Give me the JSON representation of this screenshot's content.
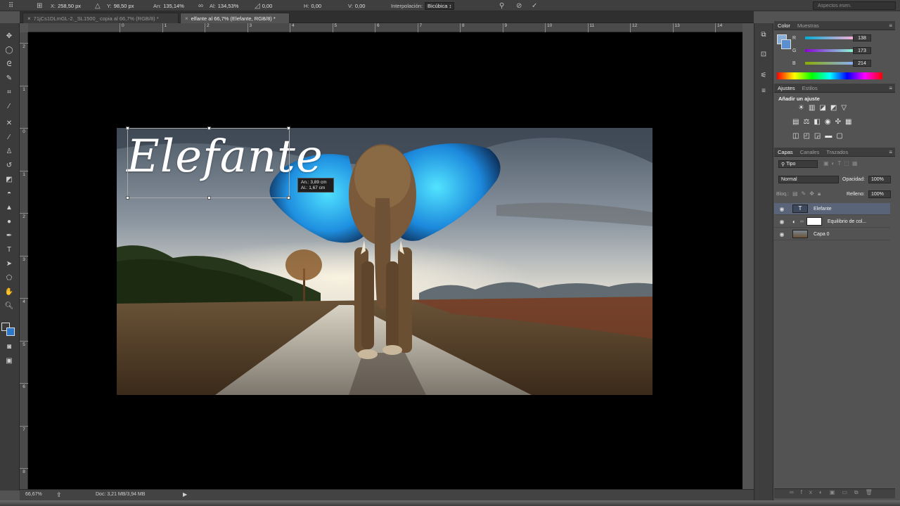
{
  "options_bar": {
    "x_label": "X:",
    "x_value": "258,50 px",
    "y_label": "Y:",
    "y_value": "98,50 px",
    "w_label": "An:",
    "w_value": "135,14%",
    "h_label": "Al:",
    "h_value": "134,53%",
    "angle_value": "0,00",
    "hskew_label": "H:",
    "hskew_value": "0,00",
    "vskew_label": "V:",
    "vskew_value": "0,00",
    "interp_label": "Interpolación:",
    "interp_value": "Bicúbica",
    "workspace_placeholder": "Aspectos esen."
  },
  "tabs": [
    {
      "label": "71jCs1DLmGL-2._SL1500_ copia al 66,7% (RGB/8) *"
    },
    {
      "label": "elfante al 66,7% (Elefante, RGB/8) *"
    }
  ],
  "ruler_top": [
    "0",
    "1",
    "2",
    "3",
    "4",
    "5",
    "6",
    "7",
    "8",
    "9",
    "10",
    "11",
    "12",
    "13",
    "14"
  ],
  "ruler_left": [
    "2",
    "1",
    "0",
    "1",
    "2",
    "3",
    "4",
    "5",
    "6",
    "7",
    "8"
  ],
  "canvas": {
    "title_text": "Elefante",
    "tooltip_w": "An.: 3,89 cm",
    "tooltip_h": "Al.: 1,67 cm"
  },
  "status": {
    "zoom": "66,67%",
    "doc": "Doc: 3,21 MB/3,94 MB"
  },
  "color_panel": {
    "tab_color": "Color",
    "tab_swatches": "Muestras",
    "r_label": "R",
    "r_value": "138",
    "g_label": "G",
    "g_value": "173",
    "b_label": "B",
    "b_value": "214",
    "fg_color": "#8aadd6"
  },
  "adjust_panel": {
    "tab_adjust": "Ajustes",
    "tab_styles": "Estilos",
    "heading": "Añadir un ajuste"
  },
  "layers_panel": {
    "tab_layers": "Capas",
    "tab_channels": "Canales",
    "tab_paths": "Trazados",
    "filter_label": "Tipo",
    "blend_mode": "Normal",
    "opacity_label": "Opacidad:",
    "opacity_value": "100%",
    "lock_label": "Bloq.:",
    "fill_label": "Relleno:",
    "fill_value": "100%",
    "layers": [
      {
        "name": "Elefante"
      },
      {
        "name": "Equilibrio de col..."
      },
      {
        "name": "Capa 0"
      }
    ]
  }
}
